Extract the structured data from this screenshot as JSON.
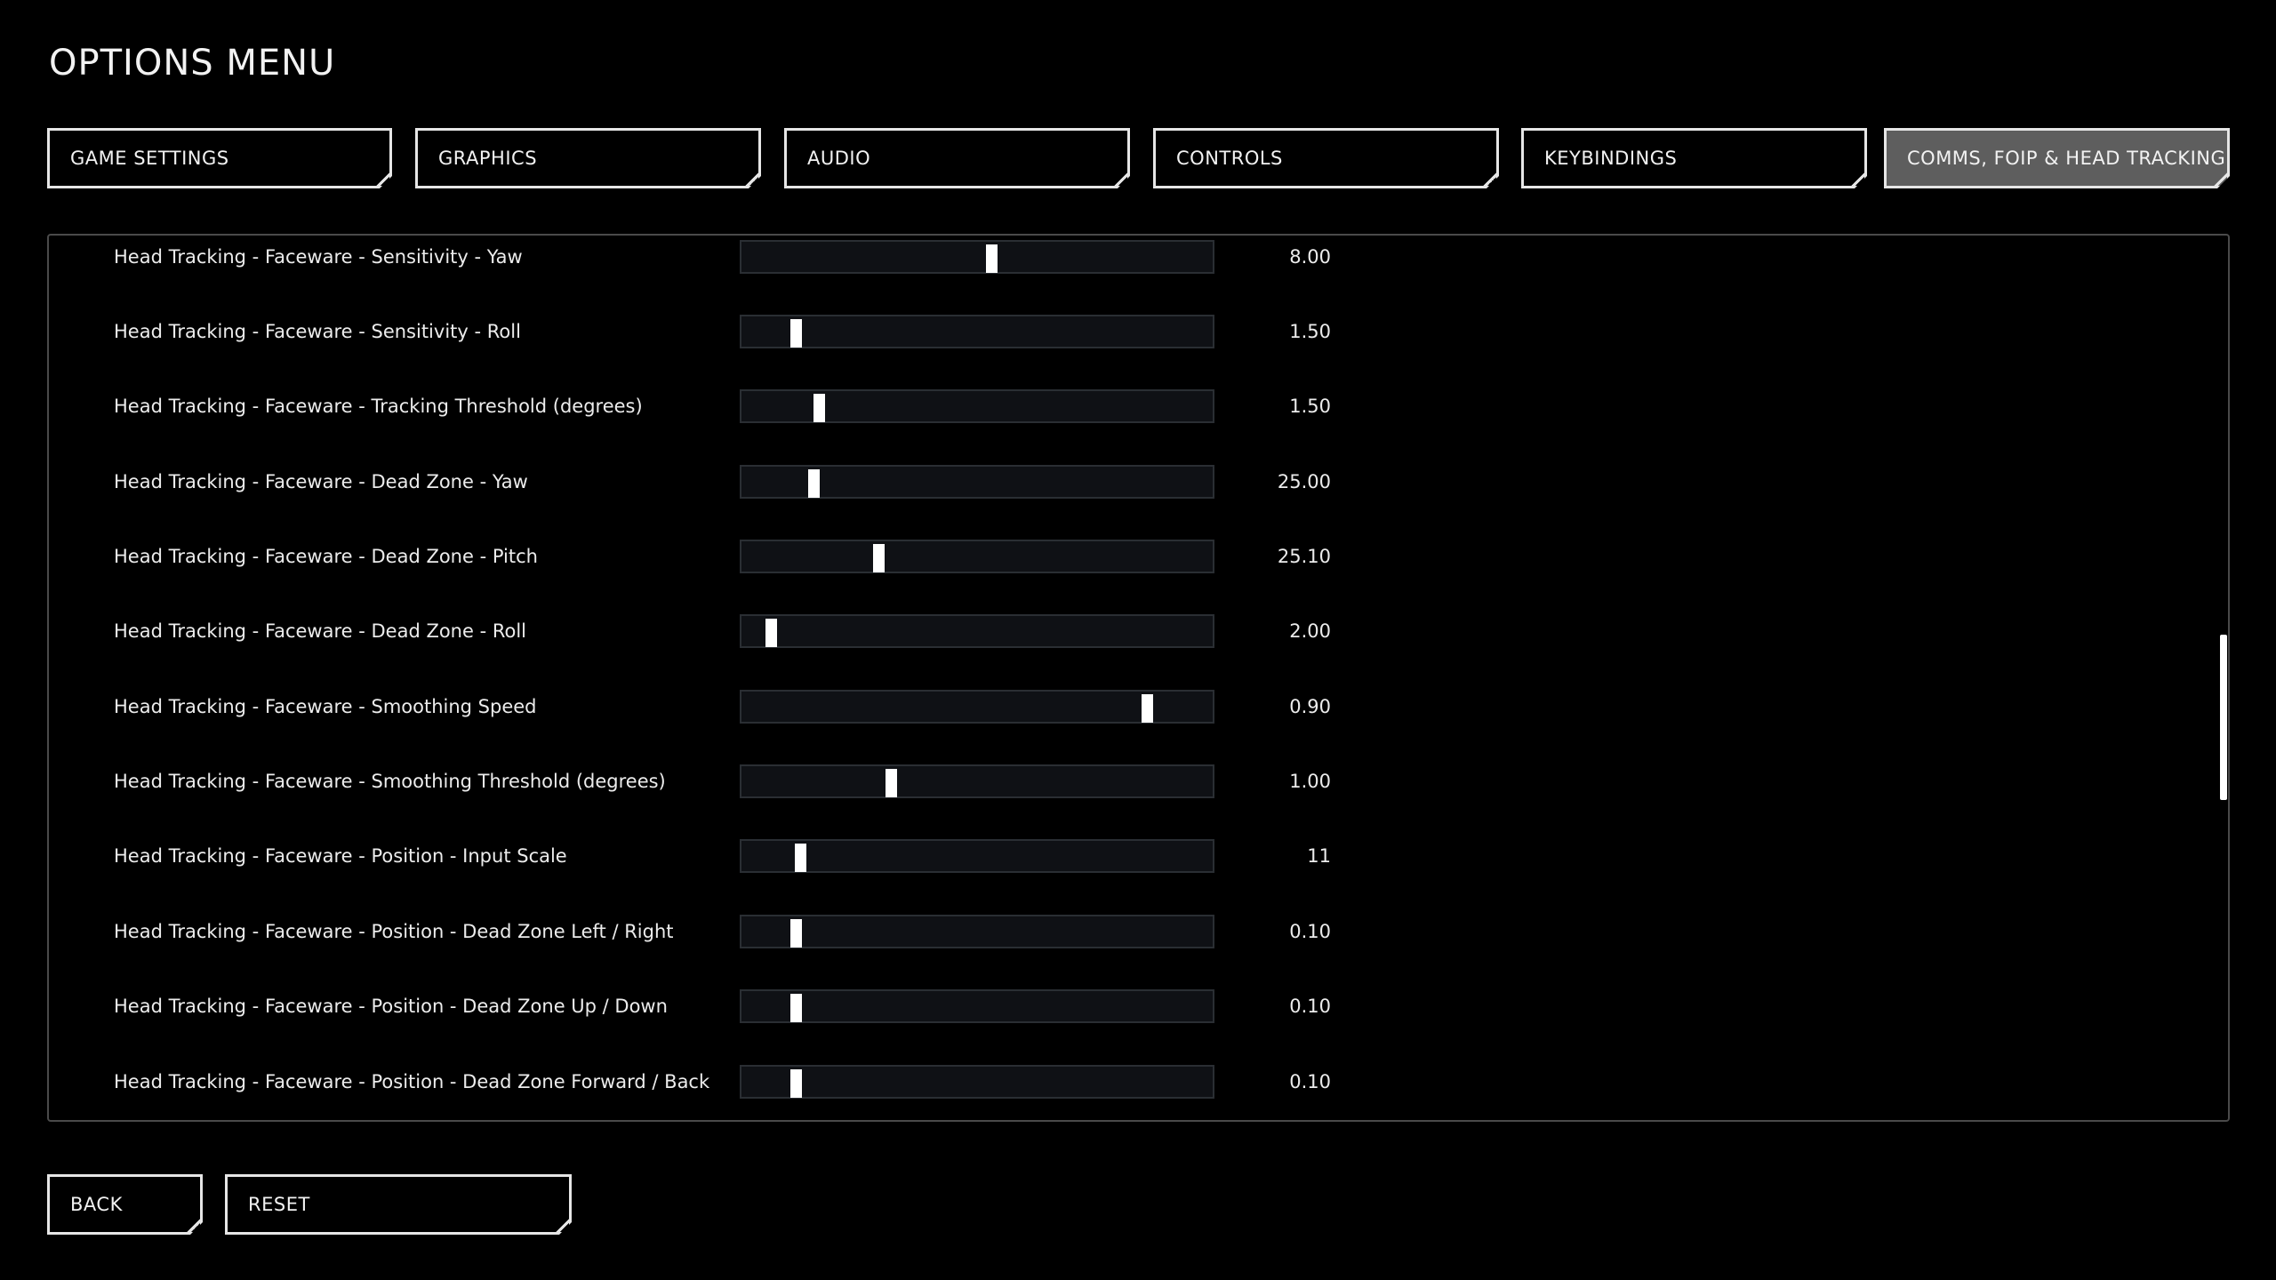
{
  "title": "OPTIONS MENU",
  "tabs": [
    {
      "label": "GAME SETTINGS",
      "active": false
    },
    {
      "label": "GRAPHICS",
      "active": false
    },
    {
      "label": "AUDIO",
      "active": false
    },
    {
      "label": "CONTROLS",
      "active": false
    },
    {
      "label": "KEYBINDINGS",
      "active": false
    },
    {
      "label": "COMMS, FOIP & HEAD TRACKING",
      "active": true
    }
  ],
  "settings": [
    {
      "label": "Head Tracking - Faceware - Sensitivity - Yaw",
      "value": "8.00",
      "fill": 0.53
    },
    {
      "label": "Head Tracking - Faceware - Sensitivity - Roll",
      "value": "1.50",
      "fill": 0.115
    },
    {
      "label": "Head Tracking - Faceware - Tracking Threshold (degrees)",
      "value": "1.50",
      "fill": 0.165
    },
    {
      "label": "Head Tracking - Faceware - Dead Zone - Yaw",
      "value": "25.00",
      "fill": 0.153
    },
    {
      "label": "Head Tracking - Faceware - Dead Zone - Pitch",
      "value": "25.10",
      "fill": 0.29
    },
    {
      "label": "Head Tracking - Faceware - Dead Zone - Roll",
      "value": "2.00",
      "fill": 0.063
    },
    {
      "label": "Head Tracking - Faceware - Smoothing Speed",
      "value": "0.90",
      "fill": 0.86
    },
    {
      "label": "Head Tracking - Faceware - Smoothing Threshold (degrees)",
      "value": "1.00",
      "fill": 0.317
    },
    {
      "label": "Head Tracking - Faceware - Position - Input Scale",
      "value": "11",
      "fill": 0.125
    },
    {
      "label": "Head Tracking - Faceware - Position - Dead Zone Left / Right",
      "value": "0.10",
      "fill": 0.115
    },
    {
      "label": "Head Tracking - Faceware - Position - Dead Zone Up / Down",
      "value": "0.10",
      "fill": 0.115
    },
    {
      "label": "Head Tracking - Faceware - Position - Dead Zone Forward / Back",
      "value": "0.10",
      "fill": 0.115
    }
  ],
  "buttons": {
    "back": "BACK",
    "reset": "RESET"
  },
  "colors": {
    "background": "#000000",
    "text": "#f2f2f2",
    "border": "#e6e6e6",
    "active_tab": "#5e5e5e",
    "track": "#0f1115",
    "thumb": "#ffffff"
  }
}
